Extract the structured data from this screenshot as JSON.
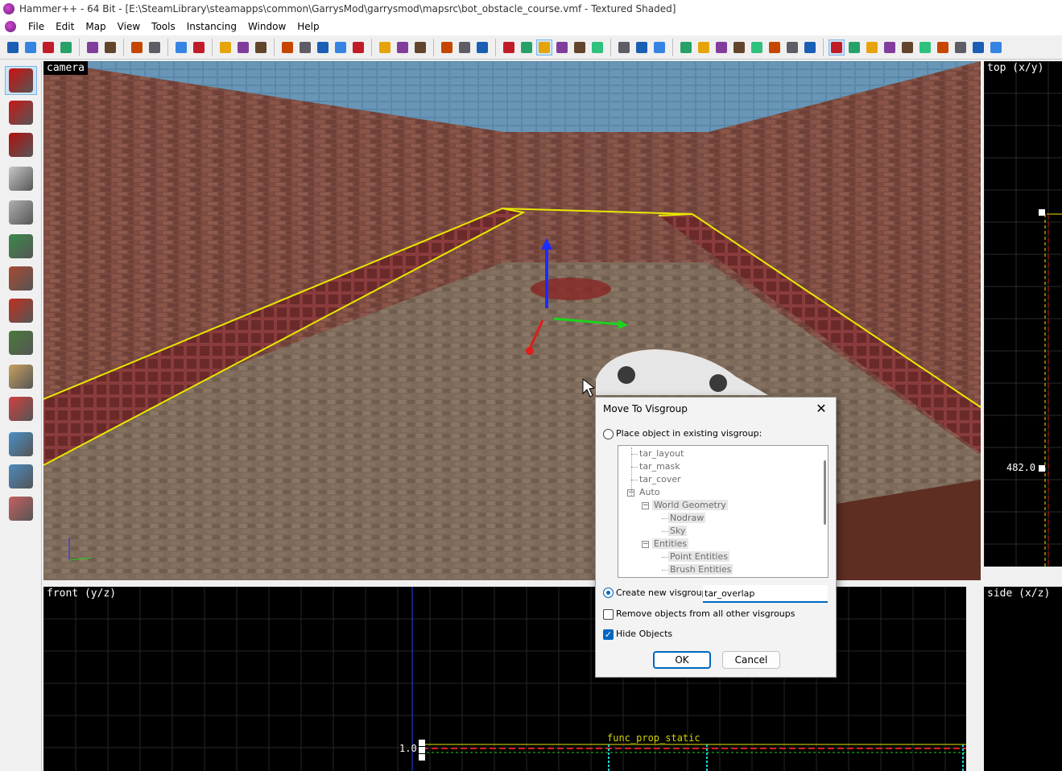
{
  "window": {
    "title": "Hammer++ - 64 Bit - [E:\\SteamLibrary\\steamapps\\common\\GarrysMod\\garrysmod\\mapsrc\\bot_obstacle_course.vmf - Textured Shaded]"
  },
  "menubar": {
    "items": [
      "File",
      "Edit",
      "Map",
      "View",
      "Tools",
      "Instancing",
      "Window",
      "Help"
    ]
  },
  "toolbar": {
    "icons": [
      "grid-toggle-icon",
      "grid-smaller-icon",
      "grid-larger-icon",
      "grid-3d-icon",
      "sep",
      "group-icon",
      "ungroup-icon",
      "sep",
      "undo-icon",
      "redo-icon",
      "sep",
      "carve-icon",
      "hollow-icon",
      "sep",
      "select-all-icon",
      "select-none-icon",
      "ignore-groups-icon",
      "sep",
      "texture-lock-icon",
      "texture-scale-lock-icon",
      "texture-browser-icon",
      "texture-replace-icon",
      "texture-apply-icon",
      "sep",
      "cut-icon",
      "copy-icon",
      "paste-icon",
      "sep",
      "hide-icon",
      "show-hidden-icon",
      "quick-hide-icon",
      "sep",
      "helpers-icon",
      "select-box-icon",
      "tie-to-entity-icon",
      "move-to-world-icon",
      "flip-icon",
      "rotate-icon",
      "sep",
      "entity-report-icon",
      "check-problems-icon",
      "run-map-icon",
      "sep",
      "toggle-models-icon",
      "toggle-sprites-icon",
      "toggle-wireframe-icon",
      "toggle-cubemaps-icon",
      "toggle-cm-icon",
      "toggle-props-icon",
      "nodraw-icon",
      "toggle-decals-icon",
      "sep",
      "snap-icon",
      "bounding-box-icon",
      "fx-icon",
      "lighting-icon",
      "vertex-icon",
      "instance-icon",
      "light-preview-icon",
      "brush-icon",
      "center-icon",
      "collision-icon"
    ]
  },
  "left_tools": [
    "selection-tool-icon",
    "magnify-tool-icon",
    "camera-tool-icon",
    "entity-tool-icon",
    "block-tool-icon",
    "texture-application-icon",
    "apply-texture-icon",
    "decal-tool-icon",
    "overlay-tool-icon",
    "clipping-tool-icon",
    "vertex-tool-icon",
    "path-tool-icon",
    "cordon-tool-icon",
    "displacement-tool-icon"
  ],
  "viewports": {
    "camera": "camera",
    "top": "top (x/y)",
    "front": "front (y/z)",
    "side": "side (x/z)",
    "top_coord": "482.0",
    "front_coord": "1.0",
    "front_entity": "func_prop_static"
  },
  "dialog": {
    "title": "Move To Visgroup",
    "close_glyph": "✕",
    "option_existing": "Place object in existing visgroup:",
    "option_new": "Create new visgroup:",
    "new_visgroup_value": "tar_overlap",
    "remove_others": "Remove objects from all other visgroups",
    "hide_objects": "Hide Objects",
    "ok": "OK",
    "cancel": "Cancel",
    "tree": [
      {
        "label": "tar_layout",
        "depth": 0,
        "expander": ""
      },
      {
        "label": "tar_mask",
        "depth": 0,
        "expander": ""
      },
      {
        "label": "tar_cover",
        "depth": 0,
        "expander": ""
      },
      {
        "label": "Auto",
        "depth": 0,
        "expander": "−"
      },
      {
        "label": "World Geometry",
        "depth": 1,
        "expander": "−"
      },
      {
        "label": "Nodraw",
        "depth": 2,
        "expander": ""
      },
      {
        "label": "Sky",
        "depth": 2,
        "expander": ""
      },
      {
        "label": "Entities",
        "depth": 1,
        "expander": "−"
      },
      {
        "label": "Point Entities",
        "depth": 2,
        "expander": ""
      },
      {
        "label": "Brush Entities",
        "depth": 2,
        "expander": ""
      }
    ],
    "state": {
      "existing_selected": false,
      "new_selected": true,
      "remove_others_checked": false,
      "hide_objects_checked": true
    }
  }
}
